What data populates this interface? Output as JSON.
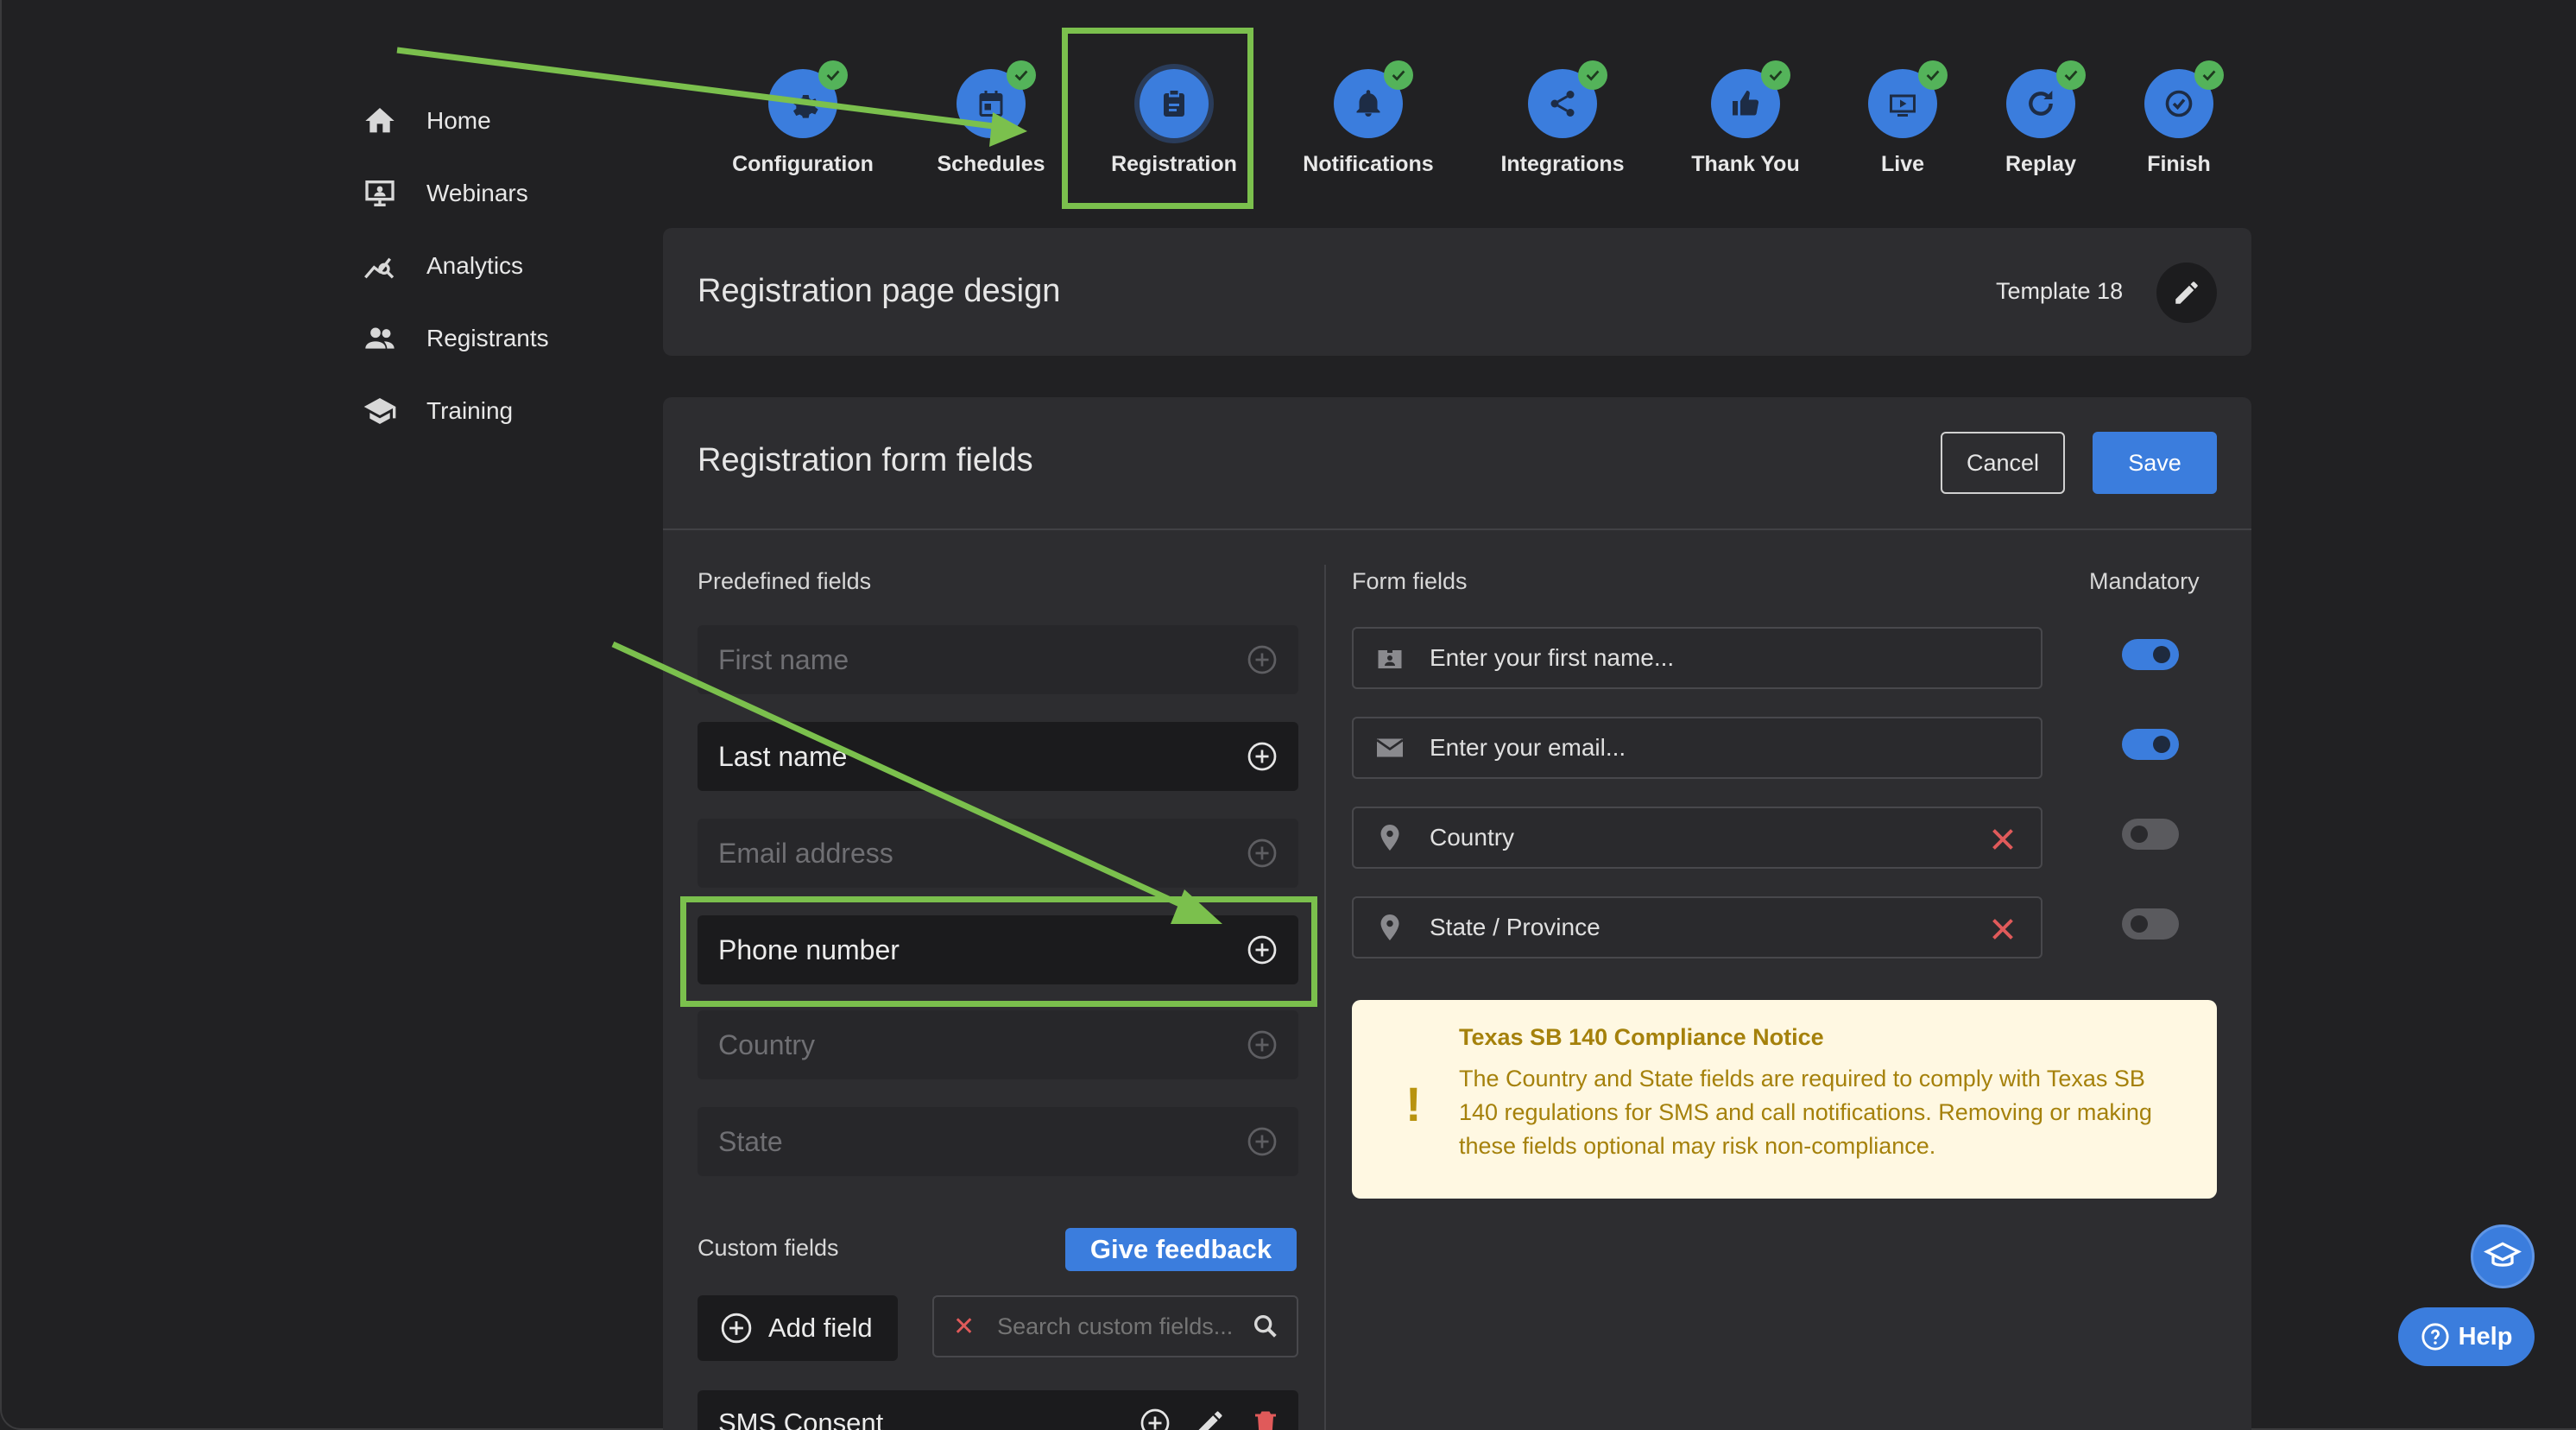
{
  "colors": {
    "accent": "#3b7ddd",
    "success": "#54b35a",
    "annotation": "#7bc04d",
    "danger": "#e05a5a",
    "warning_text": "#a5810b",
    "warning_bg": "#fff8e2"
  },
  "sidebar": {
    "items": [
      {
        "label": "Home",
        "icon": "home-icon"
      },
      {
        "label": "Webinars",
        "icon": "monitor-icon"
      },
      {
        "label": "Analytics",
        "icon": "analytics-icon"
      },
      {
        "label": "Registrants",
        "icon": "people-icon"
      },
      {
        "label": "Training",
        "icon": "graduation-cap-icon"
      }
    ]
  },
  "stepper": {
    "active": "Registration",
    "steps": [
      {
        "label": "Configuration",
        "icon": "gear-icon",
        "completed": true
      },
      {
        "label": "Schedules",
        "icon": "calendar-icon",
        "completed": true
      },
      {
        "label": "Registration",
        "icon": "clipboard-icon",
        "completed": false
      },
      {
        "label": "Notifications",
        "icon": "bell-icon",
        "completed": true
      },
      {
        "label": "Integrations",
        "icon": "share-icon",
        "completed": true
      },
      {
        "label": "Thank You",
        "icon": "thumbs-up-icon",
        "completed": true
      },
      {
        "label": "Live",
        "icon": "live-icon",
        "completed": true
      },
      {
        "label": "Replay",
        "icon": "replay-icon",
        "completed": true
      },
      {
        "label": "Finish",
        "icon": "finish-icon",
        "completed": true
      }
    ]
  },
  "design_panel": {
    "title": "Registration page design",
    "template": "Template 18"
  },
  "form_panel": {
    "title": "Registration form fields",
    "cancel": "Cancel",
    "save": "Save",
    "predefined_label": "Predefined fields",
    "form_fields_label": "Form fields",
    "mandatory_label": "Mandatory",
    "predefined": [
      {
        "label": "First name",
        "enabled": false
      },
      {
        "label": "Last name",
        "enabled": true
      },
      {
        "label": "Email address",
        "enabled": false
      },
      {
        "label": "Phone number",
        "enabled": true
      },
      {
        "label": "Country",
        "enabled": false
      },
      {
        "label": "State",
        "enabled": false
      }
    ],
    "form_fields": [
      {
        "text": "Enter your first name...",
        "icon": "id-card-icon",
        "removable": false,
        "mandatory": true
      },
      {
        "text": "Enter your email...",
        "icon": "envelope-icon",
        "removable": false,
        "mandatory": true
      },
      {
        "text": "Country",
        "icon": "location-pin-icon",
        "removable": true,
        "mandatory": false
      },
      {
        "text": "State / Province",
        "icon": "location-pin-icon",
        "removable": true,
        "mandatory": false
      }
    ],
    "notice": {
      "title": "Texas SB 140 Compliance Notice",
      "body": "The Country and State fields are required to comply with Texas SB 140 regulations for SMS and call notifications. Removing or making these fields optional may risk non-compliance."
    },
    "custom_fields_label": "Custom fields",
    "feedback": "Give feedback",
    "add_field": "Add field",
    "search_placeholder": "Search custom fields...",
    "custom_items": [
      {
        "label": "SMS Consent"
      }
    ]
  },
  "help": {
    "label": "Help"
  }
}
